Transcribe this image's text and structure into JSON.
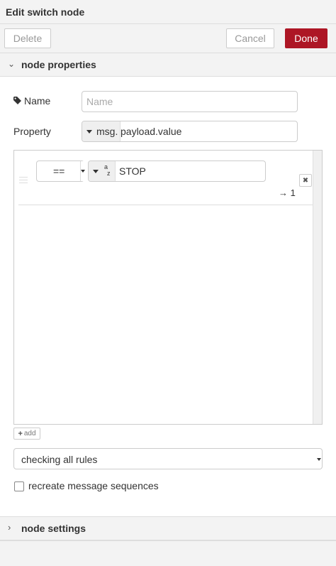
{
  "header": {
    "title": "Edit switch node"
  },
  "toolbar": {
    "delete_label": "Delete",
    "cancel_label": "Cancel",
    "done_label": "Done"
  },
  "sections": {
    "node_properties": {
      "label": "node properties",
      "expanded": true
    },
    "node_settings": {
      "label": "node settings",
      "expanded": false
    }
  },
  "form": {
    "name": {
      "label": "Name",
      "value": "",
      "placeholder": "Name",
      "icon": "tag-icon"
    },
    "property": {
      "label": "Property",
      "type_prefix": "msg.",
      "value": "payload.value"
    }
  },
  "rules": [
    {
      "operator": "==",
      "value_type": "a z",
      "value": "STOP",
      "output": "→ 1"
    }
  ],
  "rules_add_label": "add",
  "checking": {
    "selected": "checking all rules"
  },
  "recreate": {
    "label": "recreate message sequences",
    "checked": false
  },
  "colors": {
    "done_bg": "#ad1625",
    "header_bg": "#f3f3f3",
    "border": "#cccccc"
  }
}
